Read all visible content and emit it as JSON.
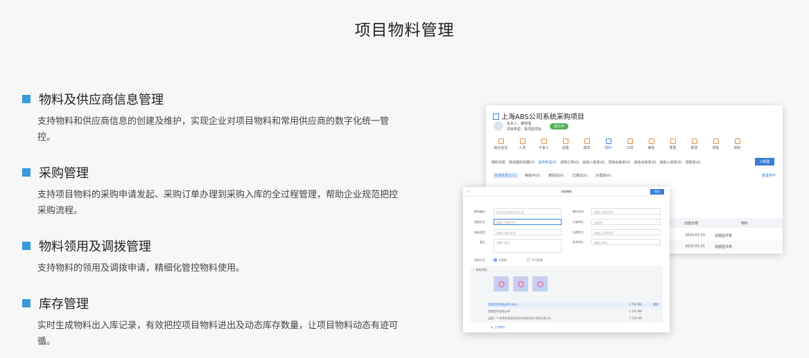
{
  "page": {
    "title": "项目物料管理"
  },
  "features": [
    {
      "title": "物料及供应商信息管理",
      "desc": "支持物料和供应商信息的创建及维护，实现企业对项目物料和常用供应商的数字化统一管控。"
    },
    {
      "title": "采购管理",
      "desc": "支持项目物料的采购申请发起、采购订单办理到采购入库的全过程管理，帮助企业规范把控采购流程。"
    },
    {
      "title": "物料领用及调拨管理",
      "desc": "支持物料的领用及调拨申请，精细化管控物料使用。"
    },
    {
      "title": "库存管理",
      "desc": "实时生成物料出入库记录，有效把控项目物料进出及动态库存数量，让项目物料动态有迹可循。"
    }
  ],
  "project_window": {
    "title": "上海ABS公司系统采购项目",
    "owner": "负责人：董明理",
    "project_type": "项目类型：事项型项目",
    "status": "进行中",
    "modules": [
      "综合信息",
      "人员",
      "干系人",
      "进度",
      "成本",
      "物料",
      "工时",
      "审批",
      "变更",
      "报告",
      "风险",
      "资料"
    ],
    "active_module": 5,
    "tabs": [
      "物料清单",
      "我创建的单据(0)",
      "采购申请(0)",
      "采购订单(0)",
      "采购入库单(0)",
      "领用出库单(0)",
      "其他出库单(0)",
      "其他入库单(0)",
      "调拨单(0)"
    ],
    "active_tab": 2,
    "new_button": "+新建",
    "subtabs": [
      "全部状态(1/1)",
      "审批中(0)",
      "被驳回(0)",
      "已通过(0)",
      "办理完(0)"
    ],
    "reset_link": "重置条件",
    "columns": [
      "创建日期",
      "物料"
    ],
    "rows": [
      {
        "date": "2020-03-21",
        "material": "铝钢型件表"
      },
      {
        "date": "2020-03-21",
        "material": "铝钢型件表"
      }
    ]
  },
  "add_material_dialog": {
    "title": "添加物料",
    "save_button": "保存",
    "close_symbol": "×",
    "fields": {
      "material_code": {
        "label": "物料编号",
        "placeholder": "保存后系统将自动生成"
      },
      "material_name": {
        "label": "物料名称",
        "placeholder": "请输入物料名称"
      },
      "spec": {
        "label": "规格型号",
        "placeholder": "请输入规格型号"
      },
      "unit": {
        "label": "计量单位",
        "placeholder": "请选择"
      },
      "category": {
        "label": "物料类型",
        "placeholder": "请输入物料类型"
      },
      "brand": {
        "label": "品牌型号",
        "placeholder": "请输入品牌型号"
      },
      "remark": {
        "label": "备注",
        "placeholder": "请输入备注"
      },
      "price": {
        "label": "参考单价",
        "placeholder": "请输入单价"
      }
    },
    "purchase_label": "采购方式",
    "purchase_options": [
      "可采购",
      "不可采购"
    ],
    "attachment_label": "物料资料",
    "files": [
      {
        "name": "铝钢型件规格说明.docx",
        "size": "1.732 MB",
        "action": "删除"
      },
      {
        "name": "铝钢型件说明.pdf",
        "size": "1.122 MB",
        "action": ""
      },
      {
        "name": "这是一个非常非常长的文件名称的文件名称示例.xls",
        "size": "7.520 KB",
        "action": ""
      }
    ],
    "upload_link": "上传附件"
  }
}
